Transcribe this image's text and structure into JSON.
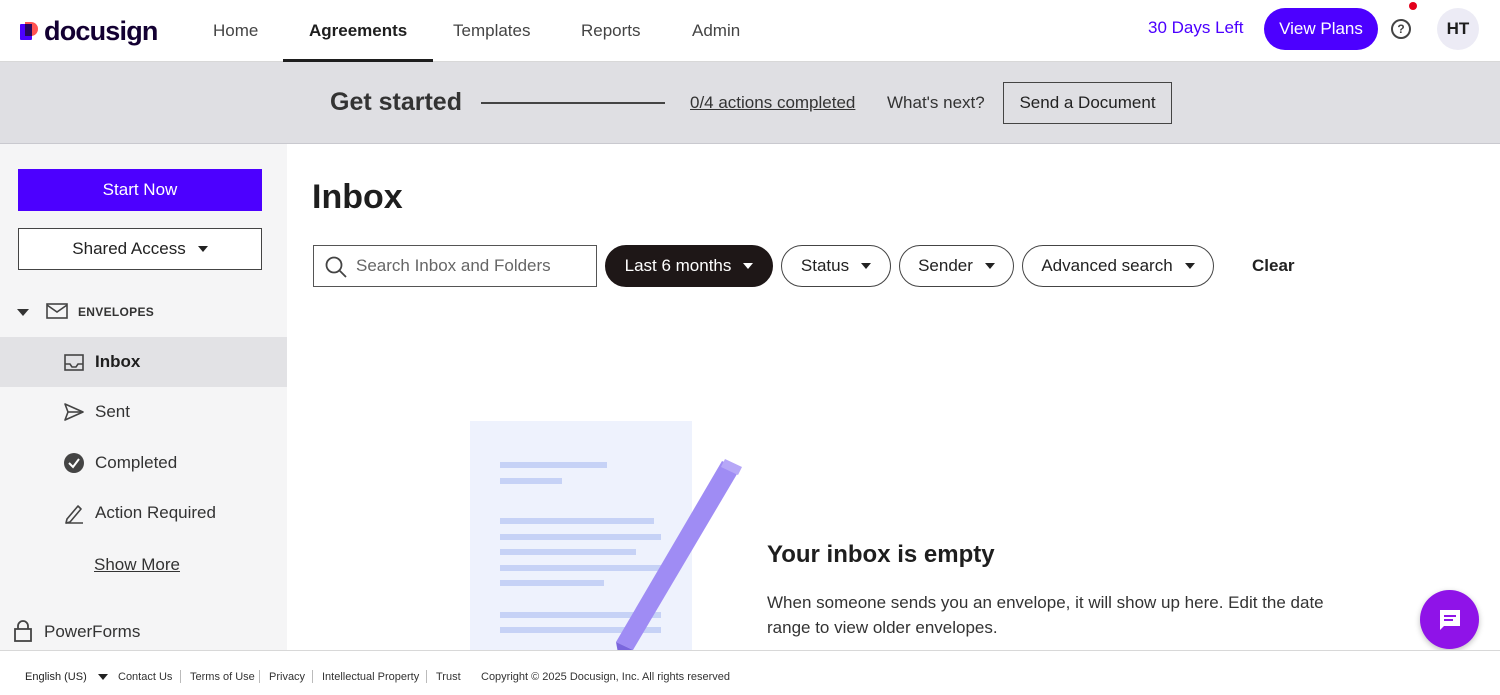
{
  "brand": {
    "name": "docusign",
    "accent": "#4c00ff",
    "logo_red": "#ff5252"
  },
  "nav": {
    "tabs": [
      {
        "label": "Home",
        "active": false
      },
      {
        "label": "Agreements",
        "active": true
      },
      {
        "label": "Templates",
        "active": false
      },
      {
        "label": "Reports",
        "active": false
      },
      {
        "label": "Admin",
        "active": false
      }
    ],
    "trial": "30 Days Left",
    "view_plans": "View Plans",
    "help_icon": "help-circle-icon",
    "help_glyph": "?",
    "avatar_initials": "HT"
  },
  "banner": {
    "title": "Get started",
    "progress": "0/4 actions completed",
    "whats_next": "What's next?",
    "send_document": "Send a Document"
  },
  "sidebar": {
    "start_now": "Start Now",
    "shared_access": "Shared Access",
    "envelopes_label": "ENVELOPES",
    "items": [
      {
        "label": "Inbox",
        "icon": "inbox-icon",
        "active": true
      },
      {
        "label": "Sent",
        "icon": "send-icon",
        "active": false
      },
      {
        "label": "Completed",
        "icon": "check-circle-icon",
        "active": false
      },
      {
        "label": "Action Required",
        "icon": "pen-icon",
        "active": false
      }
    ],
    "show_more": "Show More",
    "powerforms": "PowerForms"
  },
  "main": {
    "title": "Inbox",
    "search_placeholder": "Search Inbox and Folders",
    "filters": {
      "date": "Last 6 months",
      "status": "Status",
      "sender": "Sender",
      "advanced": "Advanced search",
      "clear": "Clear"
    },
    "empty": {
      "title": "Your inbox is empty",
      "body": "When someone sends you an envelope, it will show up here. Edit the date range to view older envelopes."
    }
  },
  "footer": {
    "language": "English (US)",
    "links": [
      "Contact Us",
      "Terms of Use",
      "Privacy",
      "Intellectual Property",
      "Trust"
    ],
    "copyright": "Copyright © 2025 Docusign, Inc. All rights reserved"
  }
}
